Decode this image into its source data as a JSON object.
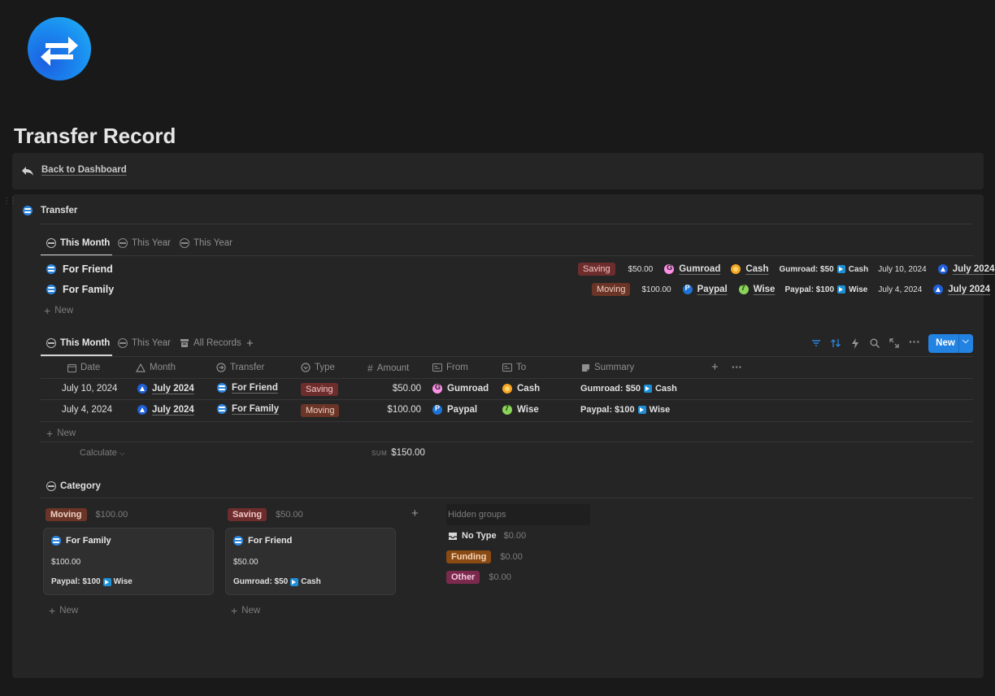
{
  "page": {
    "title": "Transfer Record",
    "back_link": "Back to Dashboard"
  },
  "transfer_view": {
    "title": "Transfer",
    "tabs": [
      "This Month",
      "This Year",
      "This Year"
    ],
    "rows": [
      {
        "name": "For Friend",
        "type": "Saving",
        "amount": "$50.00",
        "from": "Gumroad",
        "to": "Cash",
        "summary_from": "Gumroad: $50",
        "summary_to": "Cash",
        "date": "July 10, 2024",
        "month": "July 2024"
      },
      {
        "name": "For Family",
        "type": "Moving",
        "amount": "$100.00",
        "from": "Paypal",
        "to": "Wise",
        "summary_from": "Paypal: $100",
        "summary_to": "Wise",
        "date": "July 4, 2024",
        "month": "July 2024"
      }
    ],
    "new_label": "New"
  },
  "table_view": {
    "tabs": [
      "This Month",
      "This Year",
      "All Records"
    ],
    "new_button": "New",
    "columns": [
      "Date",
      "Month",
      "Transfer",
      "Type",
      "Amount",
      "From",
      "To",
      "Summary"
    ],
    "rows": [
      {
        "date": "July 10, 2024",
        "month": "July 2024",
        "transfer": "For Friend",
        "type": "Saving",
        "amount": "$50.00",
        "from": "Gumroad",
        "to": "Cash",
        "summary_from": "Gumroad: $50",
        "summary_to": "Cash"
      },
      {
        "date": "July 4, 2024",
        "month": "July 2024",
        "transfer": "For Family",
        "type": "Moving",
        "amount": "$100.00",
        "from": "Paypal",
        "to": "Wise",
        "summary_from": "Paypal: $100",
        "summary_to": "Wise"
      }
    ],
    "new_label": "New",
    "calculate_label": "Calculate",
    "sum_label": "SUM",
    "sum_value": "$150.00"
  },
  "category_view": {
    "title": "Category",
    "groups": [
      {
        "tag": "Moving",
        "total": "$100.00",
        "card_title": "For Family",
        "card_amount": "$100.00",
        "card_summary_from": "Paypal: $100",
        "card_summary_to": "Wise",
        "new_label": "New"
      },
      {
        "tag": "Saving",
        "total": "$50.00",
        "card_title": "For Friend",
        "card_amount": "$50.00",
        "card_summary_from": "Gumroad: $50",
        "card_summary_to": "Cash",
        "new_label": "New"
      }
    ],
    "hidden_groups_label": "Hidden groups",
    "hidden": [
      {
        "label": "No Type",
        "total": "$0.00"
      },
      {
        "label": "Funding",
        "total": "$0.00"
      },
      {
        "label": "Other",
        "total": "$0.00"
      }
    ]
  }
}
